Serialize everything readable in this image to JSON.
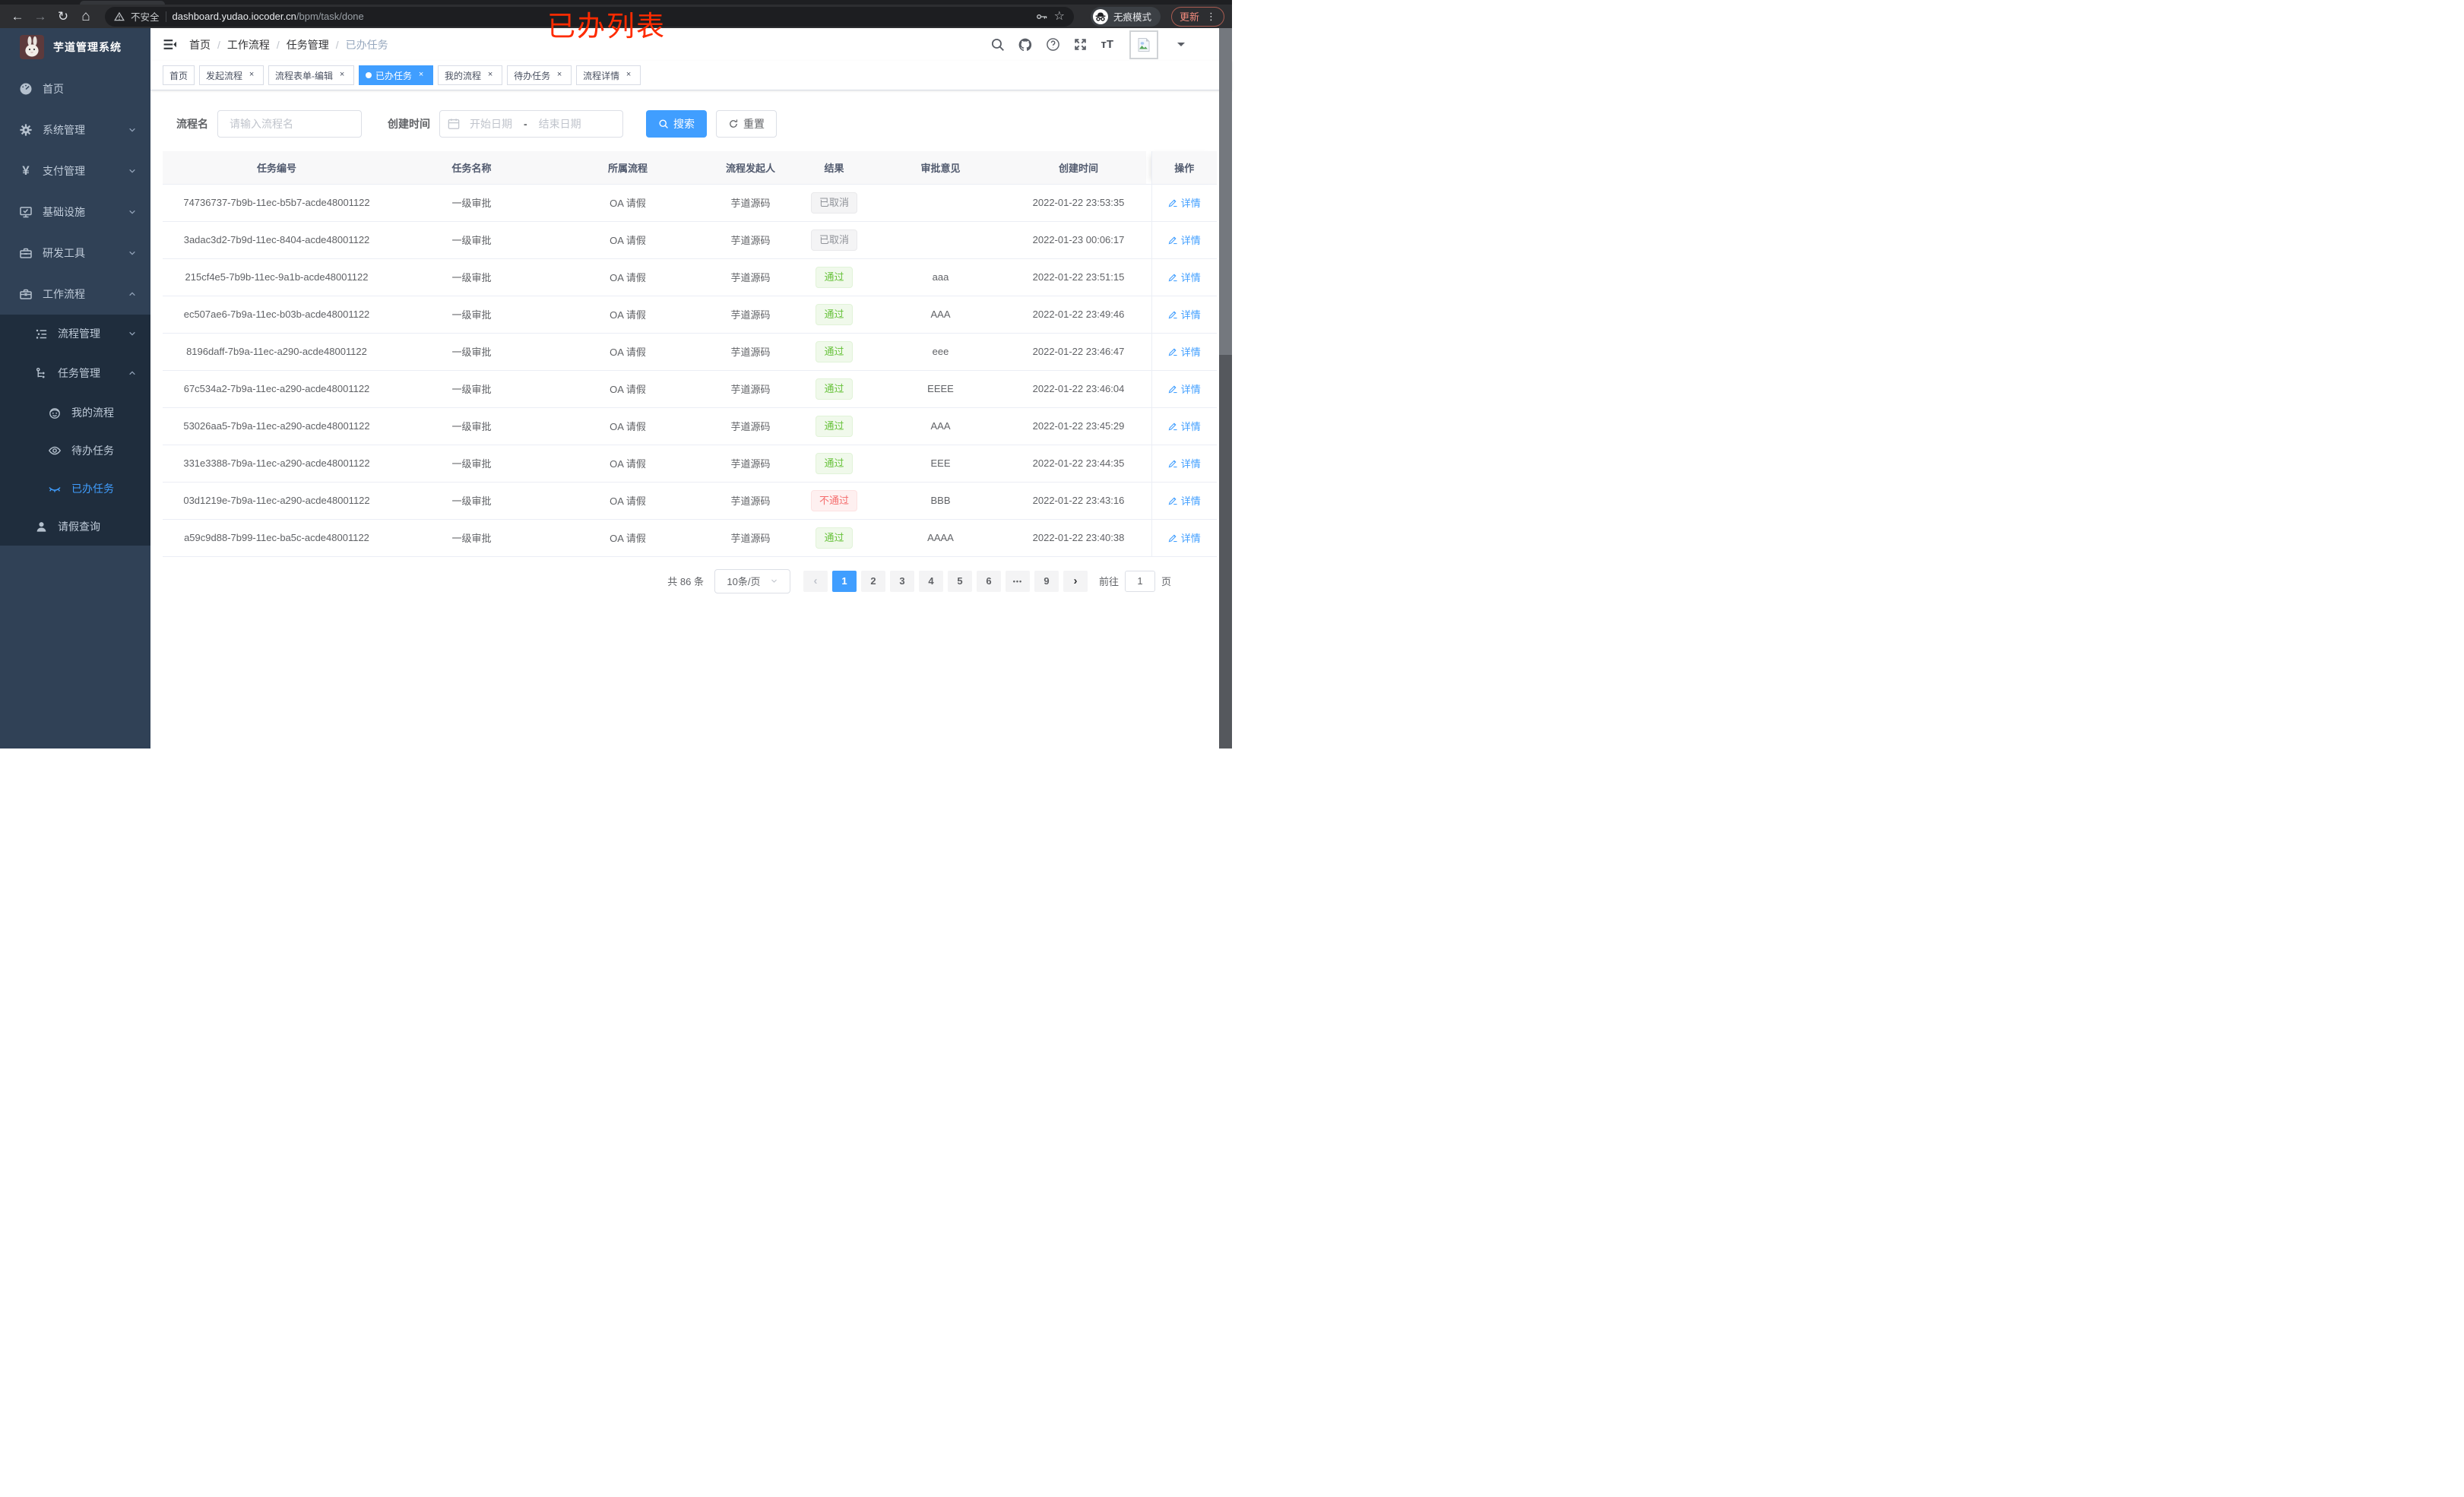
{
  "annotation": {
    "text": "已办列表",
    "color": "#fe2b00"
  },
  "browser": {
    "insecure_label": "不安全",
    "url_host": "dashboard.yudao.iocoder.cn",
    "url_path": "/bpm/task/done",
    "incognito_label": "无痕模式",
    "update_label": "更新",
    "menu_dots": "⋮"
  },
  "sidebar": {
    "logo_title": "芋道管理系统",
    "items": [
      {
        "label": "首页"
      },
      {
        "label": "系统管理"
      },
      {
        "label": "支付管理"
      },
      {
        "label": "基础设施"
      },
      {
        "label": "研发工具"
      },
      {
        "label": "工作流程"
      }
    ],
    "submenu": [
      {
        "label": "流程管理"
      },
      {
        "label": "任务管理"
      },
      {
        "label": "我的流程"
      },
      {
        "label": "待办任务"
      },
      {
        "label": "已办任务"
      },
      {
        "label": "请假查询"
      }
    ]
  },
  "navbar": {
    "breadcrumb": [
      "首页",
      "工作流程",
      "任务管理",
      "已办任务"
    ]
  },
  "tabs": [
    {
      "label": "首页",
      "closable": false,
      "active": false
    },
    {
      "label": "发起流程",
      "closable": true,
      "active": false
    },
    {
      "label": "流程表单-编辑",
      "closable": true,
      "active": false
    },
    {
      "label": "已办任务",
      "closable": true,
      "active": true
    },
    {
      "label": "我的流程",
      "closable": true,
      "active": false
    },
    {
      "label": "待办任务",
      "closable": true,
      "active": false
    },
    {
      "label": "流程详情",
      "closable": true,
      "active": false
    }
  ],
  "filters": {
    "name_label": "流程名",
    "name_placeholder": "请输入流程名",
    "time_label": "创建时间",
    "start_placeholder": "开始日期",
    "range_separator": "-",
    "end_placeholder": "结束日期",
    "search_label": "搜索",
    "reset_label": "重置"
  },
  "table": {
    "columns": [
      "任务编号",
      "任务名称",
      "所属流程",
      "流程发起人",
      "结果",
      "审批意见",
      "创建时间",
      "操作"
    ],
    "detail_label": "详情",
    "rows": [
      {
        "id": "74736737-7b9b-11ec-b5b7-acde48001122",
        "name": "一级审批",
        "process": "OA 请假",
        "starter": "芋道源码",
        "result": "已取消",
        "result_type": "info",
        "comment": "",
        "time": "2022-01-22 23:53:35"
      },
      {
        "id": "3adac3d2-7b9d-11ec-8404-acde48001122",
        "name": "一级审批",
        "process": "OA 请假",
        "starter": "芋道源码",
        "result": "已取消",
        "result_type": "info",
        "comment": "",
        "time": "2022-01-23 00:06:17"
      },
      {
        "id": "215cf4e5-7b9b-11ec-9a1b-acde48001122",
        "name": "一级审批",
        "process": "OA 请假",
        "starter": "芋道源码",
        "result": "通过",
        "result_type": "success",
        "comment": "aaa",
        "time": "2022-01-22 23:51:15"
      },
      {
        "id": "ec507ae6-7b9a-11ec-b03b-acde48001122",
        "name": "一级审批",
        "process": "OA 请假",
        "starter": "芋道源码",
        "result": "通过",
        "result_type": "success",
        "comment": "AAA",
        "time": "2022-01-22 23:49:46"
      },
      {
        "id": "8196daff-7b9a-11ec-a290-acde48001122",
        "name": "一级审批",
        "process": "OA 请假",
        "starter": "芋道源码",
        "result": "通过",
        "result_type": "success",
        "comment": "eee",
        "time": "2022-01-22 23:46:47"
      },
      {
        "id": "67c534a2-7b9a-11ec-a290-acde48001122",
        "name": "一级审批",
        "process": "OA 请假",
        "starter": "芋道源码",
        "result": "通过",
        "result_type": "success",
        "comment": "EEEE",
        "time": "2022-01-22 23:46:04"
      },
      {
        "id": "53026aa5-7b9a-11ec-a290-acde48001122",
        "name": "一级审批",
        "process": "OA 请假",
        "starter": "芋道源码",
        "result": "通过",
        "result_type": "success",
        "comment": "AAA",
        "time": "2022-01-22 23:45:29"
      },
      {
        "id": "331e3388-7b9a-11ec-a290-acde48001122",
        "name": "一级审批",
        "process": "OA 请假",
        "starter": "芋道源码",
        "result": "通过",
        "result_type": "success",
        "comment": "EEE",
        "time": "2022-01-22 23:44:35"
      },
      {
        "id": "03d1219e-7b9a-11ec-a290-acde48001122",
        "name": "一级审批",
        "process": "OA 请假",
        "starter": "芋道源码",
        "result": "不通过",
        "result_type": "danger",
        "comment": "BBB",
        "time": "2022-01-22 23:43:16"
      },
      {
        "id": "a59c9d88-7b99-11ec-ba5c-acde48001122",
        "name": "一级审批",
        "process": "OA 请假",
        "starter": "芋道源码",
        "result": "通过",
        "result_type": "success",
        "comment": "AAAA",
        "time": "2022-01-22 23:40:38"
      }
    ]
  },
  "pagination": {
    "total_label": "共 86 条",
    "page_size": "10条/页",
    "pages": [
      {
        "label": "1",
        "active": true
      },
      {
        "label": "2"
      },
      {
        "label": "3"
      },
      {
        "label": "4"
      },
      {
        "label": "5"
      },
      {
        "label": "6"
      },
      {
        "label": "•••",
        "more": true
      },
      {
        "label": "9"
      }
    ],
    "goto_label": "前往",
    "goto_value": "1",
    "page_unit": "页"
  },
  "icons": {
    "back": "left-arrow",
    "forward": "right-arrow",
    "reload": "circular-arrow",
    "home": "house",
    "warning": "triangle-exclamation",
    "key": "key",
    "star": "star-outline",
    "incognito": "spy-hat-glasses",
    "dashboard": "speedometer",
    "system": "gear",
    "pay": "yen-sign",
    "infra": "monitor-check",
    "devtool": "toolbox",
    "workflow": "briefcase",
    "process-mgmt": "tree-list",
    "task-mgmt": "flow-nodes",
    "my-process": "robot-face",
    "todo": "eye-open",
    "done": "eye-closed",
    "leave": "user",
    "search": "magnifier",
    "github": "octocat",
    "help": "question-circle",
    "fullscreen": "expand-arrows",
    "font-size": "tT",
    "avatar": "broken-image",
    "calendar": "calendar",
    "reset": "refresh-arrow",
    "detail": "edit-pen"
  }
}
